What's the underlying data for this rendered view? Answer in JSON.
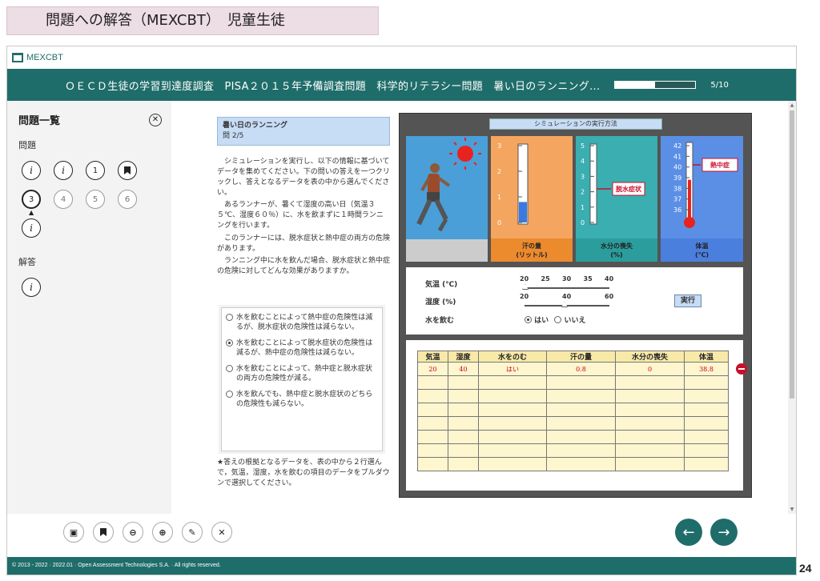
{
  "slide_title": "問題への解答（MEXCBT）　児童生徒",
  "logo": {
    "text": "MEXCBT"
  },
  "header": {
    "title": "ＯＥＣＤ生徒の学習到達度調査　PISA２０１５年予備調査問題　科学的リテラシー問題　暑い日のランニング...",
    "progress_text": "5/10",
    "progress_value": 0.5
  },
  "sidebar": {
    "title": "問題一覧",
    "section_questions": "問題",
    "section_answers": "解答",
    "questions": [
      {
        "label": "i",
        "type": "info"
      },
      {
        "label": "i",
        "type": "info"
      },
      {
        "label": "1",
        "type": "done"
      },
      {
        "label": "",
        "type": "bookmark"
      },
      {
        "label": "3",
        "type": "current"
      },
      {
        "label": "4",
        "type": "pending"
      },
      {
        "label": "5",
        "type": "pending"
      },
      {
        "label": "6",
        "type": "pending"
      },
      {
        "label": "i",
        "type": "info"
      }
    ],
    "answers": [
      {
        "label": "i"
      }
    ]
  },
  "question": {
    "header_title": "暑い日のランニング",
    "header_num": "問 2/5",
    "para1": "シミュレーションを実行し、以下の情報に基づいてデータを集めてください。下の問いの答えを一つクリックし、答えとなるデータを表の中から選んでください。",
    "para2": "あるランナーが、暑くて湿度の高い日（気温３５℃、湿度６０％）に、水を飲まずに１時間ランニングを行います。",
    "para3": "このランナーには、脱水症状と熱中症の両方の危険があります。",
    "para4": "ランニング中に水を飲んだ場合、脱水症状と熱中症の危険に対してどんな効果がありますか。",
    "options": [
      "水を飲むことによって熱中症の危険性は減るが、脱水症状の危険性は減らない。",
      "水を飲むことによって脱水症状の危険性は減るが、熱中症の危険性は減らない。",
      "水を飲むことによって、熱中症と脱水症状の両方の危険性が減る。",
      "水を飲んでも、熱中症と脱水症状のどちらの危険性も減らない。"
    ],
    "selected_option": 1,
    "footnote": "★答えの根拠となるデータを、表の中から２行選んで，気温，湿度，水を飲むの項目のデータをプルダウンで選択してください。"
  },
  "sim": {
    "title": "シミュレーションの実行方法",
    "sweat_label": "汗の量\n(リットル)",
    "water_label": "水分の喪失\n(%)",
    "temp_label": "体温\n(℃)",
    "dehydration_label": "脱水症状",
    "heatstroke_label": "熱中症",
    "sweat_ticks": [
      "3",
      "2",
      "1",
      "0"
    ],
    "water_ticks": [
      "5",
      "4",
      "3",
      "2",
      "1",
      "0"
    ],
    "temp_ticks": [
      "42",
      "41",
      "40",
      "39",
      "38",
      "37",
      "36"
    ],
    "sweat_value": 0.8,
    "water_value": 0,
    "temp_value": 38.8,
    "control_temp": "気温 (℃)",
    "control_humidity": "湿度 (%)",
    "control_water": "水を飲む",
    "temp_ticks_slider": [
      "20",
      "25",
      "30",
      "35",
      "40"
    ],
    "humidity_ticks_slider": [
      "20",
      "40",
      "60"
    ],
    "yes": "はい",
    "no": "いいえ",
    "run": "実行",
    "table_headers": [
      "気温",
      "湿度",
      "水をのむ",
      "汗の量",
      "水分の喪失",
      "体温"
    ],
    "table_rows": [
      [
        "20",
        "40",
        "はい",
        "0.8",
        "0",
        "38.8"
      ]
    ],
    "empty_rows": 7
  },
  "footer": {
    "copyright": "© 2013 - 2022 · 2022.01 · Open Assessment Technologies S.A. · All rights reserved."
  },
  "page_number": "24",
  "colors": {
    "teal": "#1f6d6a",
    "sweat": "#f4a560",
    "water": "#3aaeb0",
    "temp": "#5b8fe6",
    "alert": "#d4001a"
  }
}
